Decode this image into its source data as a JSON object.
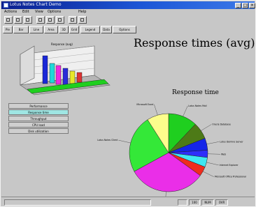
{
  "window": {
    "title": "Lotus Notes Chart Demo",
    "controls": [
      "_",
      "□",
      "×"
    ]
  },
  "menu": [
    "Actions",
    "Edit",
    "View",
    "Options",
    "Help"
  ],
  "toolbar_icons": [
    "new-icon",
    "open-icon",
    "save-icon",
    "cut-icon",
    "copy-icon",
    "paste-icon",
    "print-icon",
    "help-icon"
  ],
  "view_tabs": [
    "Pie",
    "Bar",
    "Line",
    "Area",
    "3D",
    "Grid",
    "Legend",
    "Data",
    "Options"
  ],
  "left_chart": {
    "label": "Response (avg)"
  },
  "chart_title": "Response times (avg)",
  "list": {
    "items": [
      "Performance",
      "Response time",
      "Throughput",
      "CPU load",
      "Disk utilization"
    ],
    "selected_index": 1
  },
  "pie_title": "Response time",
  "chart_data": {
    "type": "pie",
    "title": "Response time",
    "labels": [
      "Lotus Notes Mail",
      "Oracle Database",
      "Lotus Domino Server",
      "Web",
      "Internet Explorer",
      "Microsoft Office Professional",
      "Excel Application",
      "Lotus Notes Client",
      "Microsoft Excel"
    ],
    "values": [
      12,
      7,
      5,
      3,
      4,
      4,
      32,
      24,
      9
    ],
    "colors": [
      "#1fcf1f",
      "#4d7a17",
      "#1525e8",
      "#2e2efa",
      "#3fe6f2",
      "#ef2c1e",
      "#ea2ee8",
      "#34e838",
      "#fdfd8c"
    ]
  },
  "status": {
    "cells": [
      "",
      "",
      "100",
      "NUM",
      "OVR"
    ]
  }
}
